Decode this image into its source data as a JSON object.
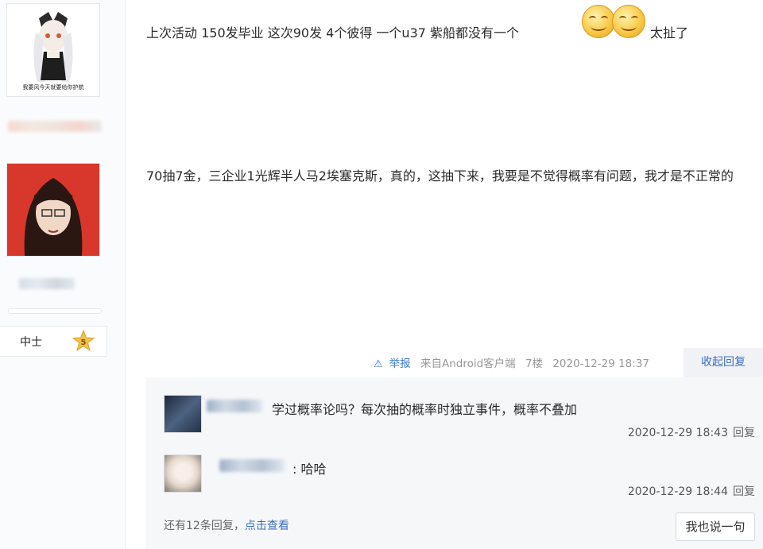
{
  "user1": {
    "avatar_caption": "我要风今天就要给你护航"
  },
  "user2": {
    "rank_title": "中士",
    "rank_level": "5"
  },
  "post": {
    "line1_a": "上次活动 150发毕业 这次90发 4个彼得 一个u37 紫船都没有一个",
    "line1_b": "太扯了",
    "line2": "70抽7金，三企业1光辉半人马2埃塞克斯，真的，这抽下来，我要是不觉得概率有问题，我才是不正常的"
  },
  "meta": {
    "report_label": "举报",
    "source": "来自Android客户端",
    "floor": "7楼",
    "time": "2020-12-29 18:37",
    "collapse_label": "收起回复"
  },
  "replies": [
    {
      "text": "学过概率论吗？每次抽的概率时独立事件，概率不叠加",
      "time": "2020-12-29 18:43",
      "reply_label": "回复"
    },
    {
      "text": ": 哈哈",
      "time": "2020-12-29 18:44",
      "reply_label": "回复"
    }
  ],
  "more": {
    "prefix": "还有12条回复，",
    "link": "点击查看"
  },
  "say_button": "我也说一句",
  "colors": {
    "link_blue": "#3b6fc2",
    "report_blue": "#3b7bd6",
    "badge_gold": "#f1c24a"
  }
}
